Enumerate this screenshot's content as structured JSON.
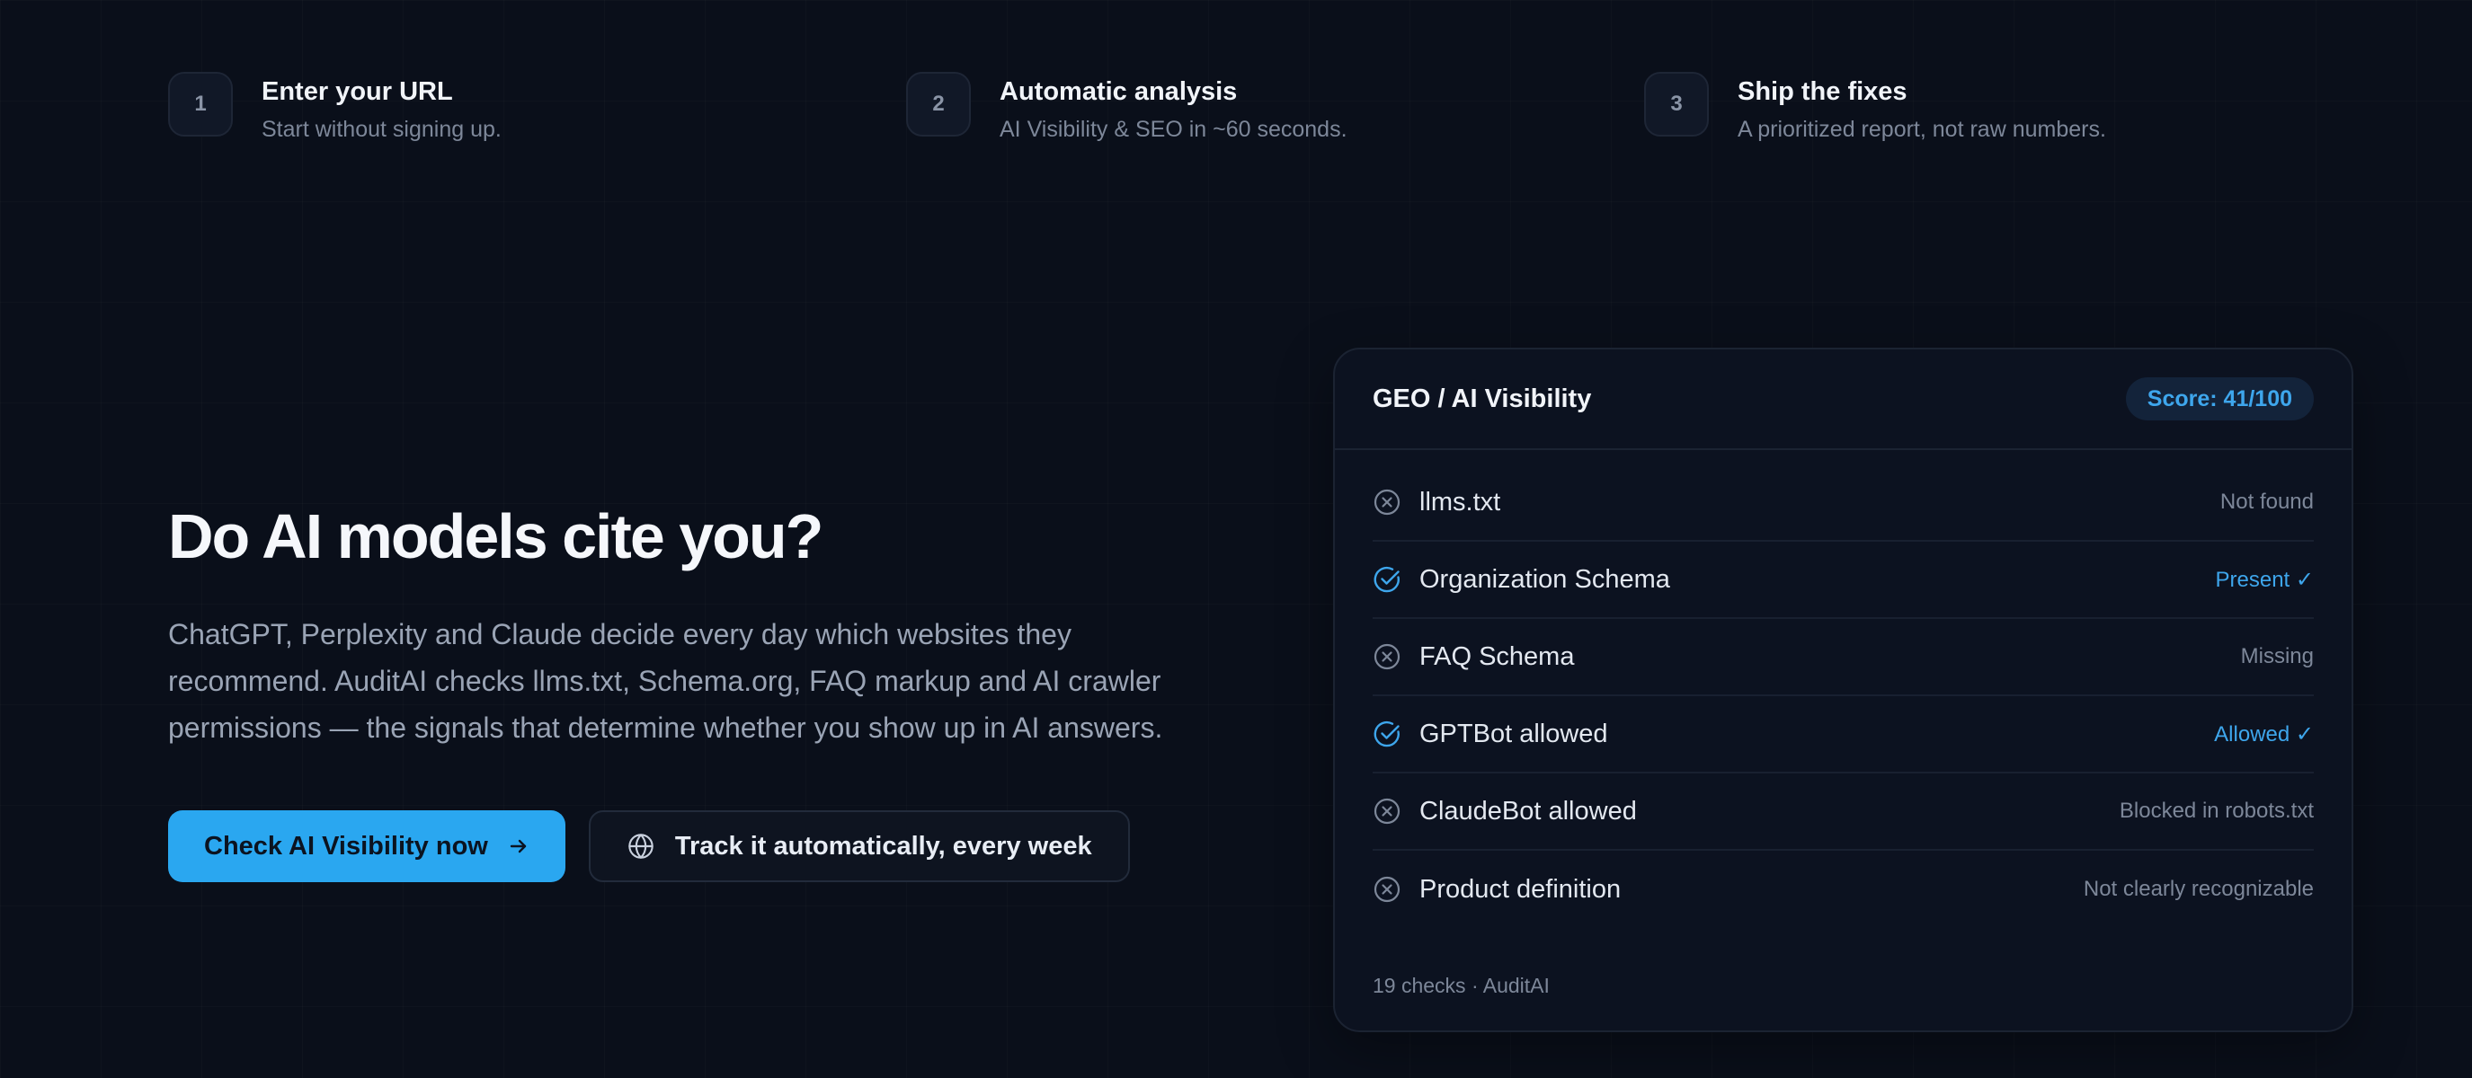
{
  "steps": [
    {
      "num": "1",
      "title": "Enter your URL",
      "desc": "Start without signing up."
    },
    {
      "num": "2",
      "title": "Automatic analysis",
      "desc": "AI Visibility & SEO in ~60 seconds."
    },
    {
      "num": "3",
      "title": "Ship the fixes",
      "desc": "A prioritized report, not raw numbers."
    }
  ],
  "hero": {
    "title": "Do AI models cite you?",
    "description": "ChatGPT, Perplexity and Claude decide every day which websites they recommend. AuditAI checks llms.txt, Schema.org, FAQ markup and AI crawler permissions — the signals that determine whether you show up in AI answers.",
    "primary_cta": "Check AI Visibility now",
    "secondary_cta": "Track it automatically, every week"
  },
  "card": {
    "title": "GEO / AI Visibility",
    "score": "Score: 41/100",
    "rows": [
      {
        "label": "llms.txt",
        "status": "Not found",
        "passed": false
      },
      {
        "label": "Organization Schema",
        "status": "Present ✓",
        "passed": true
      },
      {
        "label": "FAQ Schema",
        "status": "Missing",
        "passed": false
      },
      {
        "label": "GPTBot allowed",
        "status": "Allowed ✓",
        "passed": true
      },
      {
        "label": "ClaudeBot allowed",
        "status": "Blocked in robots.txt",
        "passed": false
      },
      {
        "label": "Product definition",
        "status": "Not clearly recognizable",
        "passed": false
      }
    ],
    "footer": "19 checks · AuditAI"
  },
  "colors": {
    "background": "#0a0f1a",
    "accent": "#2aa7f0",
    "pass": "#3ea6ec",
    "fail": "#7d8799"
  },
  "icons": {
    "pass": "check-circle-icon",
    "fail": "x-circle-icon",
    "primary_cta": "arrow-right-icon",
    "secondary_cta": "globe-icon"
  }
}
